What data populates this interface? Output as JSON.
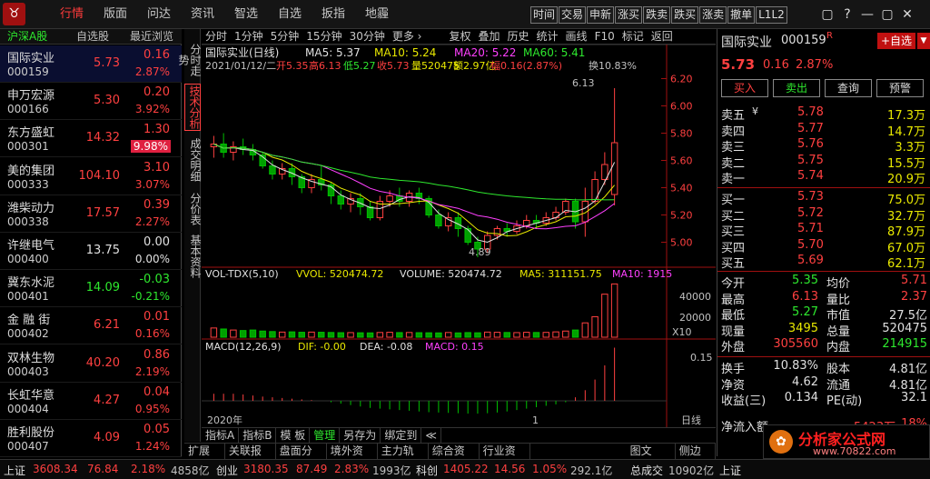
{
  "menu": {
    "logo": "♉",
    "items": [
      "行情",
      "版面",
      "问达",
      "资讯",
      "智选",
      "自选",
      "扳指",
      "地霾"
    ],
    "active": 0,
    "tools": [
      "时间",
      "交易",
      "申新",
      "涨买",
      "跌卖",
      "跌买",
      "涨卖",
      "撤单",
      "L1L2"
    ],
    "win": [
      "▢",
      "?",
      "—",
      "▢",
      "✕"
    ]
  },
  "left": {
    "headers": [
      "沪深A股",
      "自选股",
      "最近浏览"
    ],
    "rows": [
      {
        "name": "国际实业",
        "code": "000159",
        "price": "5.73",
        "chg": "0.16",
        "pct": "2.87%",
        "dir": "up",
        "sel": true
      },
      {
        "name": "申万宏源",
        "code": "000166",
        "price": "5.30",
        "chg": "0.20",
        "pct": "3.92%",
        "dir": "up"
      },
      {
        "name": "东方盛虹",
        "code": "000301",
        "price": "14.32",
        "chg": "1.30",
        "pct": "9.98%",
        "dir": "up",
        "limit": true
      },
      {
        "name": "美的集团",
        "code": "000333",
        "price": "104.10",
        "chg": "3.10",
        "pct": "3.07%",
        "dir": "up"
      },
      {
        "name": "潍柴动力",
        "code": "000338",
        "price": "17.57",
        "chg": "0.39",
        "pct": "2.27%",
        "dir": "up"
      },
      {
        "name": "许继电气",
        "code": "000400",
        "price": "13.75",
        "chg": "0.00",
        "pct": "0.00%",
        "dir": "flat"
      },
      {
        "name": "冀东水泥",
        "code": "000401",
        "price": "14.09",
        "chg": "-0.03",
        "pct": "-0.21%",
        "dir": "down"
      },
      {
        "name": "金 融 街",
        "code": "000402",
        "price": "6.21",
        "chg": "0.01",
        "pct": "0.16%",
        "dir": "up"
      },
      {
        "name": "双林生物",
        "code": "000403",
        "price": "40.20",
        "chg": "0.86",
        "pct": "2.19%",
        "dir": "up"
      },
      {
        "name": "长虹华意",
        "code": "000404",
        "price": "4.27",
        "chg": "0.04",
        "pct": "0.95%",
        "dir": "up"
      },
      {
        "name": "胜利股份",
        "code": "000407",
        "price": "4.09",
        "chg": "0.05",
        "pct": "1.24%",
        "dir": "up"
      }
    ]
  },
  "vtabs": [
    "分时走势",
    "技术分析",
    "成交明细",
    "分价表",
    "基本资料"
  ],
  "chart": {
    "tools": [
      "分时",
      "1分钟",
      "5分钟",
      "15分钟",
      "30分钟",
      "更多 ›",
      "复权",
      "叠加",
      "历史",
      "统计",
      "画线",
      "F10",
      "标记",
      "返回"
    ],
    "header": {
      "title": "国际实业(日线)",
      "ma5": "MA5: 5.37",
      "ma10": "MA10: 5.24",
      "ma20": "MA20: 5.22",
      "ma60": "MA60: 5.41"
    },
    "info": {
      "date": "2021/01/12/二",
      "open": "开5.35",
      "high": "高6.13",
      "low": "低5.27",
      "close": "收5.73",
      "vol": "量520475",
      "amt": "额2.97亿",
      "amp": "幅0.16(2.87%)",
      "turn": "换10.83%"
    },
    "yticks": [
      "6.20",
      "6.00",
      "5.80",
      "5.60",
      "5.40",
      "5.20",
      "5.00"
    ],
    "high_mark": "6.13",
    "low_mark": "4.89",
    "vol_header": {
      "name": "VOL-TDX(5,10)",
      "vvol": "VVOL: 520474.72",
      "volume": "VOLUME: 520474.72",
      "ma5": "MA5: 311151.75",
      "ma10": "MA10: 1915"
    },
    "vol_ticks": [
      "40000",
      "20000"
    ],
    "vol_unit": "X10",
    "macd_header": {
      "name": "MACD(12,26,9)",
      "dif": "DIF: -0.00",
      "dea": "DEA: -0.08",
      "macd": "MACD: 0.15"
    },
    "macd_ticks": [
      "0.15"
    ],
    "year_label": "2020年",
    "month_label": "1",
    "period_label": "日线",
    "bottom_tabs": [
      "指标A",
      "指标B",
      "模 板",
      "管理",
      "另存为",
      "绑定到",
      "≪"
    ],
    "ext_tabs": [
      "扩展 ∧",
      "关联报价",
      "盘面分析",
      "境外资金",
      "主力轨迹",
      "综合资讯",
      "行业资讯",
      "图文F10",
      "侧边栏"
    ]
  },
  "chart_data": {
    "type": "candlestick",
    "title": "国际实业(日线)",
    "ylim": [
      4.85,
      6.25
    ],
    "candles": [
      [
        5.7,
        5.72,
        5.78,
        5.62
      ],
      [
        5.72,
        5.66,
        5.8,
        5.62
      ],
      [
        5.66,
        5.7,
        5.74,
        5.6
      ],
      [
        5.7,
        5.68,
        5.76,
        5.64
      ],
      [
        5.68,
        5.64,
        5.72,
        5.6
      ],
      [
        5.64,
        5.56,
        5.66,
        5.54
      ],
      [
        5.56,
        5.5,
        5.6,
        5.46
      ],
      [
        5.5,
        5.54,
        5.58,
        5.46
      ],
      [
        5.54,
        5.48,
        5.58,
        5.42
      ],
      [
        5.48,
        5.4,
        5.5,
        5.36
      ],
      [
        5.4,
        5.46,
        5.5,
        5.36
      ],
      [
        5.46,
        5.42,
        5.56,
        5.38
      ],
      [
        5.42,
        5.34,
        5.44,
        5.28
      ],
      [
        5.34,
        5.28,
        5.38,
        5.24
      ],
      [
        5.28,
        5.32,
        5.36,
        5.22
      ],
      [
        5.32,
        5.26,
        5.36,
        5.2
      ],
      [
        5.26,
        5.18,
        5.3,
        5.16
      ],
      [
        5.18,
        5.3,
        5.34,
        5.16
      ],
      [
        5.3,
        5.34,
        5.38,
        5.26
      ],
      [
        5.34,
        5.3,
        5.4,
        5.26
      ],
      [
        5.3,
        5.36,
        5.38,
        5.26
      ],
      [
        5.36,
        5.32,
        5.4,
        5.28
      ],
      [
        5.32,
        5.2,
        5.34,
        5.18
      ],
      [
        5.2,
        5.12,
        5.24,
        5.1
      ],
      [
        5.12,
        5.18,
        5.22,
        5.08
      ],
      [
        5.18,
        5.1,
        5.22,
        5.04
      ],
      [
        5.1,
        5.0,
        5.12,
        4.98
      ],
      [
        5.0,
        4.95,
        5.04,
        4.89
      ],
      [
        4.95,
        5.05,
        5.08,
        4.92
      ],
      [
        5.05,
        5.1,
        5.12,
        5.02
      ],
      [
        5.1,
        5.08,
        5.14,
        5.04
      ],
      [
        5.08,
        5.12,
        5.16,
        5.06
      ],
      [
        5.12,
        5.16,
        5.2,
        5.1
      ],
      [
        5.16,
        5.14,
        5.2,
        5.1
      ],
      [
        5.14,
        5.18,
        5.22,
        5.12
      ],
      [
        5.18,
        5.22,
        5.26,
        5.16
      ],
      [
        5.22,
        5.3,
        5.32,
        5.2
      ],
      [
        5.3,
        5.15,
        5.32,
        5.1
      ],
      [
        5.15,
        5.3,
        5.4,
        5.04
      ],
      [
        5.3,
        5.46,
        5.52,
        5.28
      ],
      [
        5.46,
        5.57,
        5.66,
        5.42
      ],
      [
        5.35,
        5.73,
        6.13,
        5.27
      ]
    ],
    "volumes": [
      9000,
      8000,
      7000,
      6500,
      7000,
      6000,
      5500,
      5000,
      5200,
      4800,
      5000,
      4800,
      4600,
      4400,
      4500,
      4300,
      4200,
      4600,
      4800,
      4500,
      4600,
      4400,
      4300,
      4200,
      4600,
      4200,
      4500,
      4300,
      5000,
      4800,
      4600,
      4500,
      4800,
      4600,
      4700,
      5200,
      6000,
      7000,
      14000,
      20000,
      42000,
      52000
    ],
    "macd": [
      0.02,
      0.02,
      0.02,
      0.018,
      0.015,
      0.012,
      0.01,
      0.008,
      0.006,
      0.004,
      0.002,
      0.0,
      -0.004,
      -0.008,
      -0.012,
      -0.016,
      -0.02,
      -0.022,
      -0.024,
      -0.026,
      -0.028,
      -0.03,
      -0.032,
      -0.033,
      -0.034,
      -0.035,
      -0.036,
      -0.036,
      -0.035,
      -0.033,
      -0.03,
      -0.026,
      -0.022,
      -0.018,
      -0.014,
      -0.01,
      -0.004,
      0.01,
      0.03,
      0.06,
      0.1,
      0.15
    ]
  },
  "right": {
    "name": "国际实业",
    "code": "000159",
    "badge": "R",
    "add_btn": "+自选",
    "price": "5.73",
    "chg": "0.16",
    "pct": "2.87%",
    "buttons": [
      "买入",
      "卖出",
      "查询",
      "预警"
    ],
    "asks": [
      [
        "卖五",
        "5.78",
        "17.3万"
      ],
      [
        "卖四",
        "5.77",
        "14.7万"
      ],
      [
        "卖三",
        "5.76",
        "3.3万"
      ],
      [
        "卖二",
        "5.75",
        "15.5万"
      ],
      [
        "卖一",
        "5.74",
        "20.9万"
      ]
    ],
    "ask_mark": "¥",
    "bids": [
      [
        "买一",
        "5.73",
        "75.0万"
      ],
      [
        "买二",
        "5.72",
        "32.7万"
      ],
      [
        "买三",
        "5.71",
        "87.9万"
      ],
      [
        "买四",
        "5.70",
        "67.0万"
      ],
      [
        "买五",
        "5.69",
        "62.1万"
      ]
    ],
    "stats": [
      [
        "今开",
        "5.35",
        "均价",
        "5.71"
      ],
      [
        "最高",
        "6.13",
        "量比",
        "2.37"
      ],
      [
        "最低",
        "5.27",
        "市值",
        "27.5亿"
      ],
      [
        "现量",
        "3495",
        "总量",
        "520475"
      ],
      [
        "外盘",
        "305560",
        "内盘",
        "214915"
      ]
    ],
    "stats2": [
      [
        "换手",
        "10.83%",
        "股本",
        "4.81亿"
      ],
      [
        "净资",
        "4.62",
        "流通",
        "4.81亿"
      ],
      [
        "收益(三)",
        "0.134",
        "PE(动)",
        "32.1"
      ]
    ],
    "netflow": "净流入额",
    "netflow_val": "5423万",
    "netflow_pct": "18%"
  },
  "status": {
    "sh": "上证",
    "sh_v": "3608.34",
    "sh_c": "76.84",
    "sh_p": "2.18%",
    "sh_a": "4858亿",
    "cy": "创业",
    "cy_v": "3180.35",
    "cy_c": "87.49",
    "cy_p": "2.83%",
    "cy_a": "1993亿",
    "kc": "科创",
    "kc_v": "1405.22",
    "kc_c": "14.56",
    "kc_p": "1.05%",
    "kc_a": "292.1亿",
    "sum": "总成交",
    "sum_v": "10902亿",
    "sh2": "上证"
  },
  "watermark": {
    "text": "分析家公式网",
    "url": "www.70822.com"
  }
}
